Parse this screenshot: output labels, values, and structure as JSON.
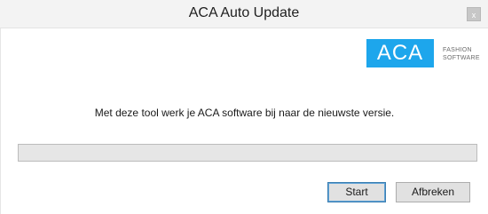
{
  "window": {
    "title": "ACA Auto Update",
    "close_label": "x"
  },
  "logo": {
    "brand": "ACA",
    "sub_line1": "FASHION",
    "sub_line2": "SOFTWARE",
    "brand_color": "#1da6ec"
  },
  "main": {
    "message": "Met deze tool werk je ACA software bij naar de nieuwste versie.",
    "progress": 0
  },
  "buttons": {
    "start_label": "Start",
    "cancel_label": "Afbreken"
  }
}
